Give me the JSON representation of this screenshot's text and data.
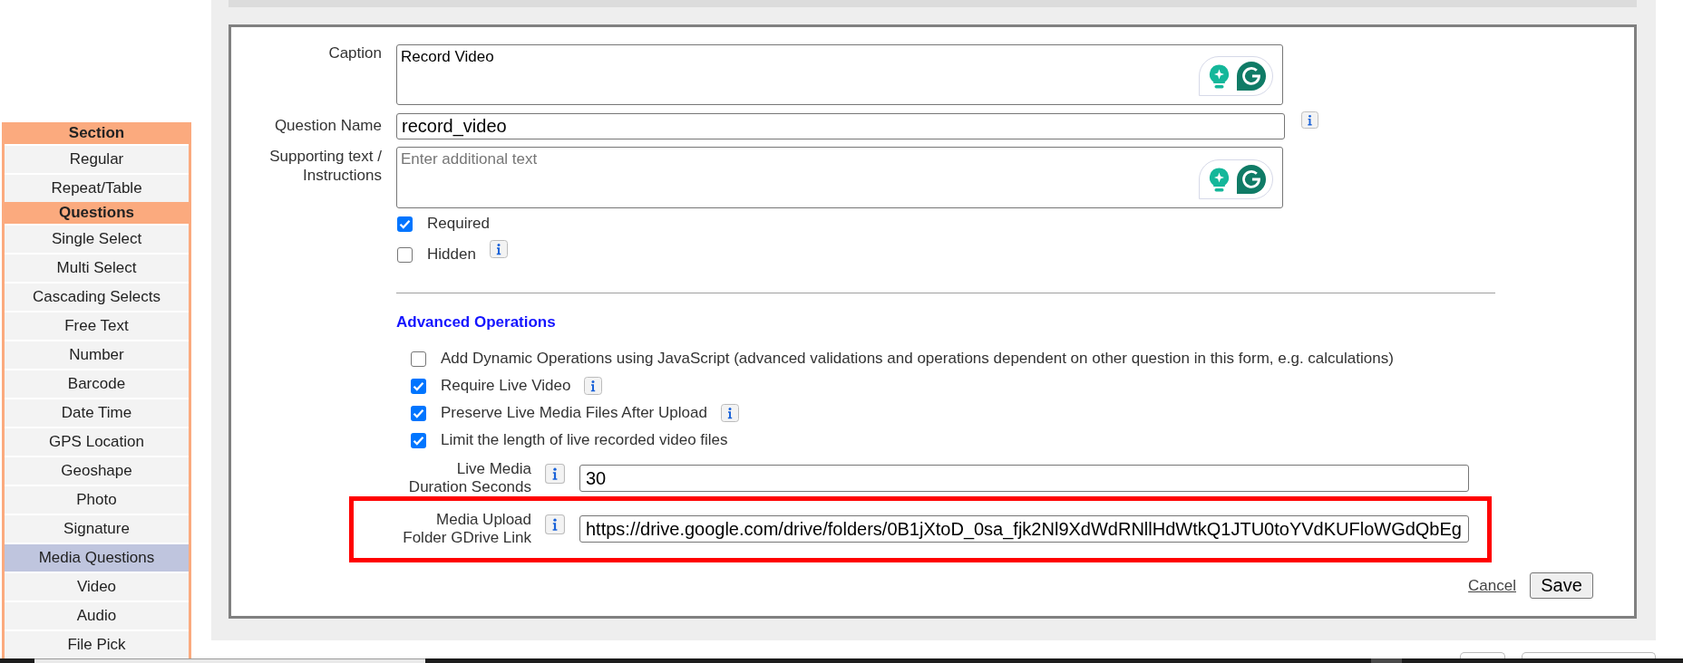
{
  "sidebar": {
    "groups": [
      {
        "title": "Section",
        "items": [
          {
            "label": "Regular",
            "selected": false
          },
          {
            "label": "Repeat/Table",
            "selected": false
          }
        ]
      },
      {
        "title": "Questions",
        "items": [
          {
            "label": "Single Select",
            "selected": false
          },
          {
            "label": "Multi Select",
            "selected": false
          },
          {
            "label": "Cascading Selects",
            "selected": false
          },
          {
            "label": "Free Text",
            "selected": false
          },
          {
            "label": "Number",
            "selected": false
          },
          {
            "label": "Barcode",
            "selected": false
          },
          {
            "label": "Date Time",
            "selected": false
          },
          {
            "label": "GPS Location",
            "selected": false
          },
          {
            "label": "Geoshape",
            "selected": false
          },
          {
            "label": "Photo",
            "selected": false
          },
          {
            "label": "Signature",
            "selected": false
          },
          {
            "label": "Media Questions",
            "selected": true
          },
          {
            "label": "Video",
            "selected": false
          },
          {
            "label": "Audio",
            "selected": false
          },
          {
            "label": "File Pick",
            "selected": false
          }
        ]
      }
    ]
  },
  "form": {
    "caption": {
      "label": "Caption",
      "value": "Record Video"
    },
    "question_name": {
      "label": "Question Name",
      "value": "record_video",
      "info": true
    },
    "supporting_text": {
      "label": "Supporting text / Instructions",
      "placeholder": "Enter additional text"
    },
    "options": [
      {
        "label": "Required",
        "checked": true,
        "info": false
      },
      {
        "label": "Hidden",
        "checked": false,
        "info": true
      }
    ],
    "advanced": {
      "title": "Advanced Operations",
      "options": [
        {
          "label": "Add Dynamic Operations using JavaScript (advanced validations and operations dependent on other question in this form, e.g. calculations)",
          "checked": false,
          "info": false
        },
        {
          "label": "Require Live Video",
          "checked": true,
          "info": true
        },
        {
          "label": "Preserve Live Media Files After Upload",
          "checked": true,
          "info": true
        },
        {
          "label": "Limit the length of live recorded video files",
          "checked": true,
          "info": false
        }
      ]
    },
    "fields": [
      {
        "label": "Live Media Duration Seconds",
        "value": "30",
        "info": true,
        "highlighted": false
      },
      {
        "label": "Media Upload Folder GDrive Link",
        "value": "https://drive.google.com/drive/folders/0B1jXtoD_0sa_fjk2Nl9XdWdRNllHdWtkQ1JTU0toYVdKUFloWGdQbEg",
        "info": true,
        "highlighted": true
      }
    ],
    "actions": {
      "cancel": "Cancel",
      "save": "Save"
    }
  }
}
